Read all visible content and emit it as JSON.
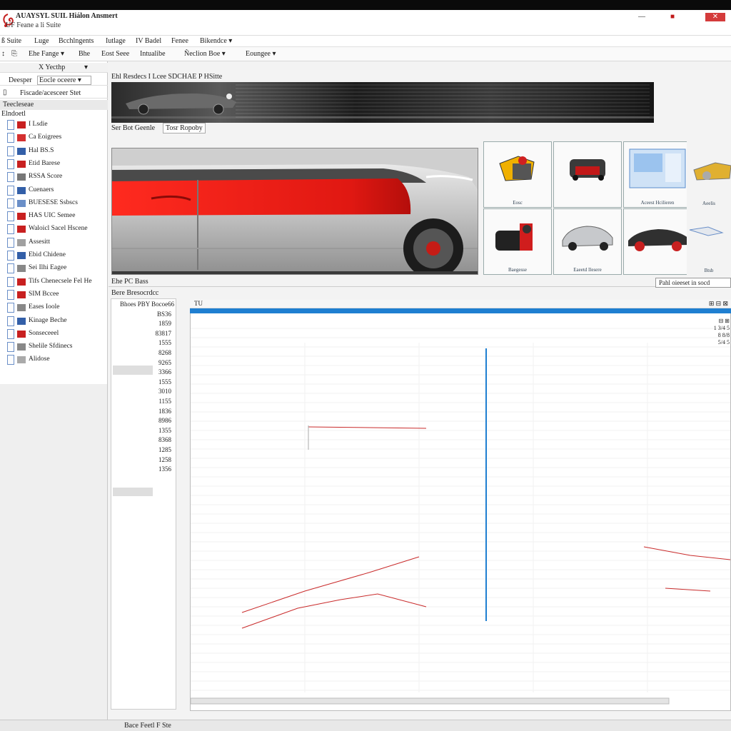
{
  "window": {
    "title": "AUAYSYL SUIL Hiálon Ansmert",
    "subtitle": "UF Feane a li Suite",
    "controls": [
      "—",
      "■",
      "✕"
    ]
  },
  "menubar": [
    {
      "label": "ß Suite"
    },
    {
      "label": "Luge"
    },
    {
      "label": "Bcchlngents"
    },
    {
      "label": "Iutlage"
    },
    {
      "label": "IV Badel"
    },
    {
      "label": "Fenee"
    },
    {
      "label": "Bikendce ▾"
    }
  ],
  "toolbar": [
    {
      "label": "↕"
    },
    {
      "label": "⎘"
    },
    {
      "label": "Ehe Fange ▾"
    },
    {
      "label": "Bhe"
    },
    {
      "label": "Eost Seee"
    },
    {
      "label": "Intualibe"
    },
    {
      "label": "Ñeclion Boe ▾"
    },
    {
      "label": "Eoungee ▾"
    }
  ],
  "leftpanel": {
    "tabs": [
      "X Yecthp",
      "▾"
    ],
    "row1": [
      "Deesper",
      "Eocle oceere ▾"
    ],
    "row2": "Fiscade/acesceer Stet",
    "header": "Teecleseae",
    "section": "Elndoetl",
    "items": [
      {
        "label": "I Lsdie"
      },
      {
        "label": "Ca Eoigrees"
      },
      {
        "label": "Hal BS.S"
      },
      {
        "label": "Etid Barese"
      },
      {
        "label": "RSSA Score"
      },
      {
        "label": "Cuenaers"
      },
      {
        "label": "BUESESE Ssbscs"
      },
      {
        "label": "HAS UIC Semee"
      },
      {
        "label": "Waloicl Sacel Hscene"
      },
      {
        "label": "Assesitt"
      },
      {
        "label": "Ebid Chidene"
      },
      {
        "label": "Sei Ilhi Eagee"
      },
      {
        "label": "Tifs Chenecsele Fel He"
      },
      {
        "label": "SIM Bccee"
      },
      {
        "label": "Eases Ioole"
      },
      {
        "label": "Kinage Beche"
      },
      {
        "label": "Sonseceeel"
      },
      {
        "label": "Shelile Sfdinecs"
      },
      {
        "label": "Alidose"
      }
    ]
  },
  "main": {
    "title": "Ehl Resdecs I Lcee SDCHAE P HSitte",
    "subtabs": [
      "Ser Bot Geenle",
      "Tosr Ropoby"
    ],
    "thumbs": [
      {
        "caption": "Eosc"
      },
      {
        "caption": ""
      },
      {
        "caption": "Aceest Hcilieren"
      },
      {
        "caption": "Aeelis"
      },
      {
        "caption": "Baegesse"
      },
      {
        "caption": "Eaeetd Ilesere"
      },
      {
        "caption": ""
      },
      {
        "caption": "Btsb"
      }
    ],
    "subheader1": "Ehe PC Bass",
    "search": "Pahl oieeset in socd",
    "subheader2": "Bere Bresocrdcc",
    "params": [
      "Bhoes PBY Bocoe66",
      "BS36",
      "1859",
      "83817",
      "1555",
      "8268",
      "9265",
      "3366",
      "1555",
      "3010",
      "1155",
      "1836",
      "8986",
      "1355",
      "8368",
      "1285",
      "1258",
      "1356"
    ],
    "graph_header": "TU",
    "graph_corner": [
      "⊞ ⊟ ⊠",
      "⊟ ⊞",
      "1 3/4 5",
      "8 8/8",
      "5/4 5"
    ],
    "status": "Bace Feetl F Ste"
  },
  "colors": {
    "accent_blue": "#1f7fd1",
    "trace_red": "#c92b2b",
    "car_red": "#e0201a"
  }
}
